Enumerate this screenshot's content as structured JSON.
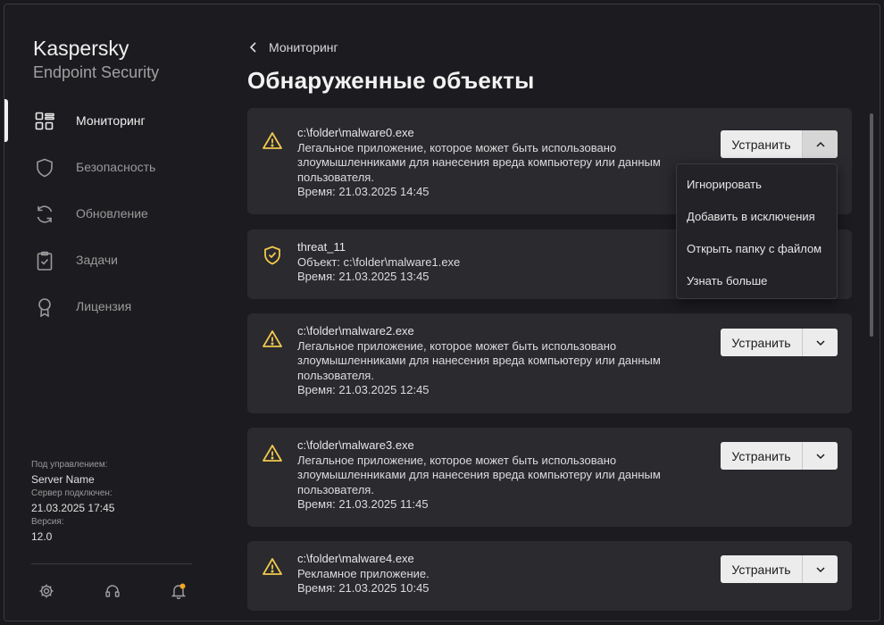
{
  "app": {
    "brand_line1": "Kaspersky",
    "brand_line2": "Endpoint Security"
  },
  "titlebar": {
    "help": "?",
    "help_icon": "question-icon",
    "minimize_icon": "minimize-icon",
    "maximize_icon": "maximize-icon",
    "close_icon": "close-icon"
  },
  "sidebar": {
    "items": [
      {
        "label": "Мониторинг",
        "icon": "monitoring-grid-icon",
        "active": true
      },
      {
        "label": "Безопасность",
        "icon": "shield-icon",
        "active": false
      },
      {
        "label": "Обновление",
        "icon": "refresh-icon",
        "active": false
      },
      {
        "label": "Задачи",
        "icon": "clipboard-check-icon",
        "active": false
      },
      {
        "label": "Лицензия",
        "icon": "license-ribbon-icon",
        "active": false
      }
    ],
    "info": {
      "managed_label": "Под управлением:",
      "managed_value": "Server Name",
      "connected_label": "Сервер подключен:",
      "connected_value": "21.03.2025 17:45",
      "version_label": "Версия:",
      "version_value": "12.0"
    },
    "bottom_icons": [
      "gear-icon",
      "headset-icon",
      "bell-icon"
    ],
    "notification_color": "#f5a623"
  },
  "main": {
    "breadcrumb": "Мониторинг",
    "title": "Обнаруженные объекты",
    "fix_label": "Устранить",
    "cards": [
      {
        "icon": "warning-icon",
        "title": "c:\\folder\\malware0.exe",
        "lines": [
          "Легальное приложение, которое может быть использовано",
          "злоумышленниками для нанесения вреда компьютеру или данным",
          "пользователя."
        ],
        "time": "Время: 21.03.2025 14:45",
        "has_button": true,
        "expanded": true
      },
      {
        "icon": "shield-check-icon",
        "title": "threat_11",
        "lines": [
          "Объект: c:\\folder\\malware1.exe"
        ],
        "time": "Время: 21.03.2025 13:45",
        "has_button": false,
        "expanded": false
      },
      {
        "icon": "warning-icon",
        "title": "c:\\folder\\malware2.exe",
        "lines": [
          "Легальное приложение, которое может быть использовано",
          "злоумышленниками для нанесения вреда компьютеру или данным",
          "пользователя."
        ],
        "time": "Время: 21.03.2025 12:45",
        "has_button": true,
        "expanded": false
      },
      {
        "icon": "warning-icon",
        "title": "c:\\folder\\malware3.exe",
        "lines": [
          "Легальное приложение, которое может быть использовано",
          "злоумышленниками для нанесения вреда компьютеру или данным",
          "пользователя."
        ],
        "time": "Время: 21.03.2025 11:45",
        "has_button": true,
        "expanded": false
      },
      {
        "icon": "warning-icon",
        "title": "c:\\folder\\malware4.exe",
        "lines": [
          "Рекламное приложение."
        ],
        "time": "Время: 21.03.2025 10:45",
        "has_button": true,
        "expanded": false
      }
    ],
    "dropdown": [
      "Игнорировать",
      "Добавить в исключения",
      "Открыть папку с файлом",
      "Узнать больше"
    ]
  },
  "colors": {
    "warning": "#f2c94c",
    "background": "#1c1c20",
    "card": "#2a2a2f",
    "button": "#ececec"
  }
}
